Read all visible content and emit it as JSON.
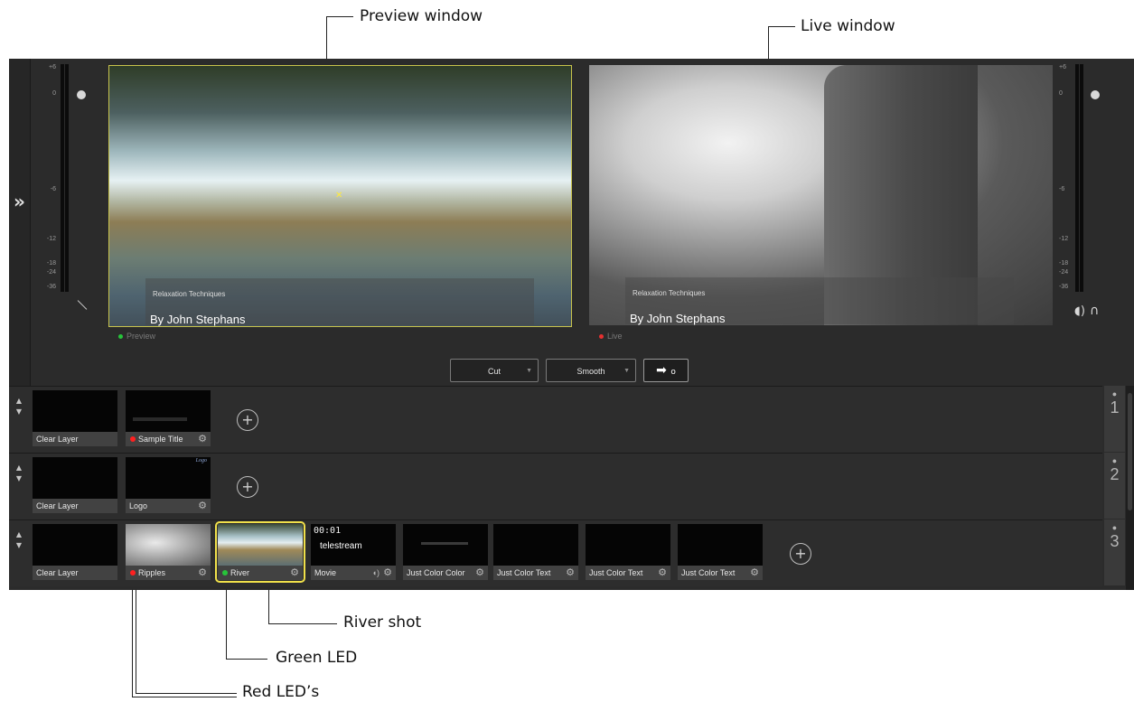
{
  "callouts": {
    "preview": "Preview window",
    "live": "Live window",
    "river": "River shot",
    "green": "Green LED",
    "red": "Red LED’s"
  },
  "sidebar": {
    "expand_icon": "double-chevron-right-icon"
  },
  "meters": {
    "scale": [
      "+6",
      "0",
      "-6",
      "-12",
      "-18",
      "-24",
      "-36"
    ]
  },
  "preview": {
    "lower_third_small": "Relaxation Techniques",
    "lower_third_big": "By John Stephans",
    "status": "Preview",
    "status_color": "#27c43a"
  },
  "live": {
    "lower_third_small": "Relaxation Techniques",
    "lower_third_big": "By John Stephans",
    "status": "Live",
    "status_color": "#e53030"
  },
  "transitions": {
    "cut": "Cut",
    "smooth": "Smooth",
    "go_icon": "arrow-right-icon"
  },
  "layers": [
    {
      "number": "1",
      "add_icon": "plus-circle-icon",
      "shots": [
        {
          "label": "Clear Layer"
        },
        {
          "label": "Sample Title",
          "led": "#ff2020"
        }
      ]
    },
    {
      "number": "2",
      "add_icon": "plus-circle-icon",
      "shots": [
        {
          "label": "Clear Layer"
        },
        {
          "label": "Logo",
          "thumb_text": "Logo"
        }
      ]
    },
    {
      "number": "3",
      "add_icon": "plus-circle-icon",
      "shots": [
        {
          "label": "Clear Layer"
        },
        {
          "label": "Ripples",
          "led": "#ff2020"
        },
        {
          "label": "River",
          "led": "#27c43a",
          "selected": true
        },
        {
          "label": "Movie",
          "timecode": "00:01",
          "brand": "telestream"
        },
        {
          "label": "Just Color Color"
        },
        {
          "label": "Just Color Text"
        },
        {
          "label": "Just Color Text"
        },
        {
          "label": "Just Color Text"
        }
      ]
    }
  ],
  "accent_colors": {
    "selection": "#f0e04a",
    "led_red": "#ff2020",
    "led_green": "#27c43a"
  }
}
